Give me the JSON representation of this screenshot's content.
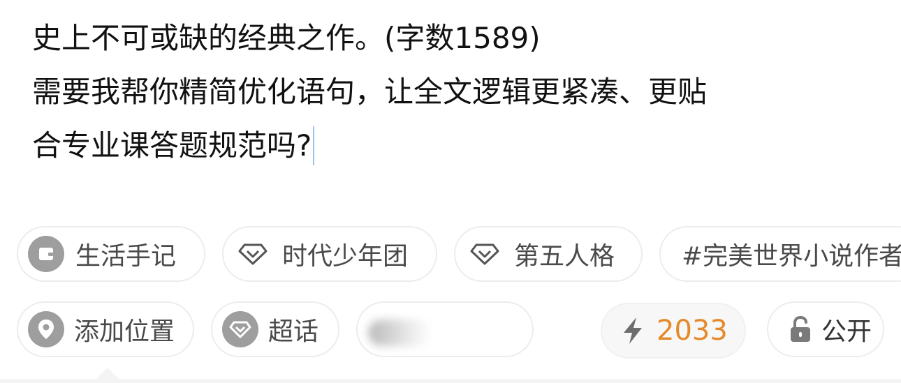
{
  "post": {
    "lines": [
      "史上不可或缺的经典之作。(字数1589)",
      "需要我帮你精简优化语句，让全文逻辑更紧凑、更贴",
      "合专业课答题规范吗?"
    ]
  },
  "topic_chips": [
    {
      "label": "生活手记",
      "icon": "notebook-icon"
    },
    {
      "label": "时代少年团",
      "icon": "diamond-icon"
    },
    {
      "label": "第五人格",
      "icon": "diamond-icon"
    },
    {
      "label": "#完美世界小说作者",
      "icon": ""
    }
  ],
  "toolbar": {
    "location_label": "添加位置",
    "location_icon": "location-pin-icon",
    "super_topic_label": "超话",
    "super_topic_icon": "diamond-icon",
    "boost_count": "2033",
    "boost_icon": "lightning-icon",
    "visibility_label": "公开",
    "visibility_icon": "unlock-icon"
  },
  "colors": {
    "text": "#111111",
    "chip_text": "#4a4a4a",
    "chip_border": "#ececec",
    "icon_gray": "#9e9e9e",
    "accent_orange": "#e48a2a",
    "caret": "#9fc3f2"
  }
}
